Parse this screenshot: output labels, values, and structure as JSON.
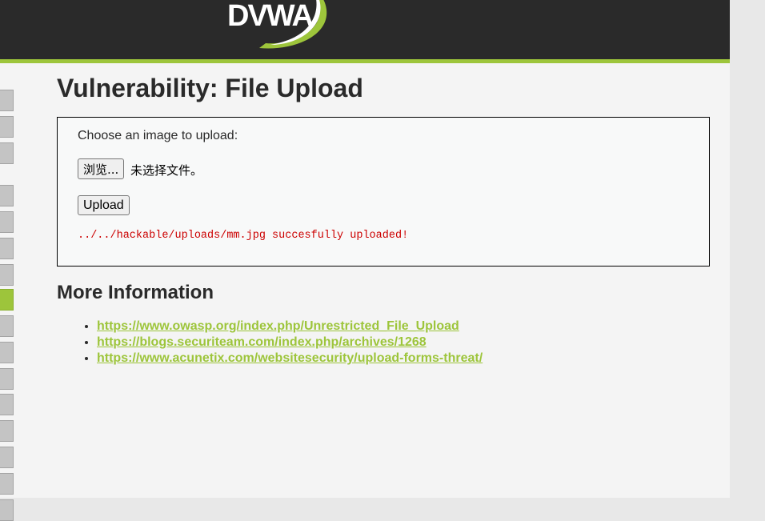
{
  "logo": {
    "text": "DVWA"
  },
  "page": {
    "title": "Vulnerability: File Upload"
  },
  "sidebar": {
    "tab_count": 16,
    "selected_index": 7
  },
  "upload_form": {
    "prompt": "Choose an image to upload:",
    "browse_label": "浏览...",
    "file_status": "未选择文件。",
    "upload_label": "Upload",
    "result_message": "../../hackable/uploads/mm.jpg succesfully uploaded!"
  },
  "more_info": {
    "heading": "More Information",
    "links": [
      "https://www.owasp.org/index.php/Unrestricted_File_Upload",
      "https://blogs.securiteam.com/index.php/archives/1268",
      "https://www.acunetix.com/websitesecurity/upload-forms-threat/"
    ]
  },
  "colors": {
    "accent": "#9dc53b",
    "header_bg": "#2a2a2a",
    "error": "#cc0000"
  }
}
